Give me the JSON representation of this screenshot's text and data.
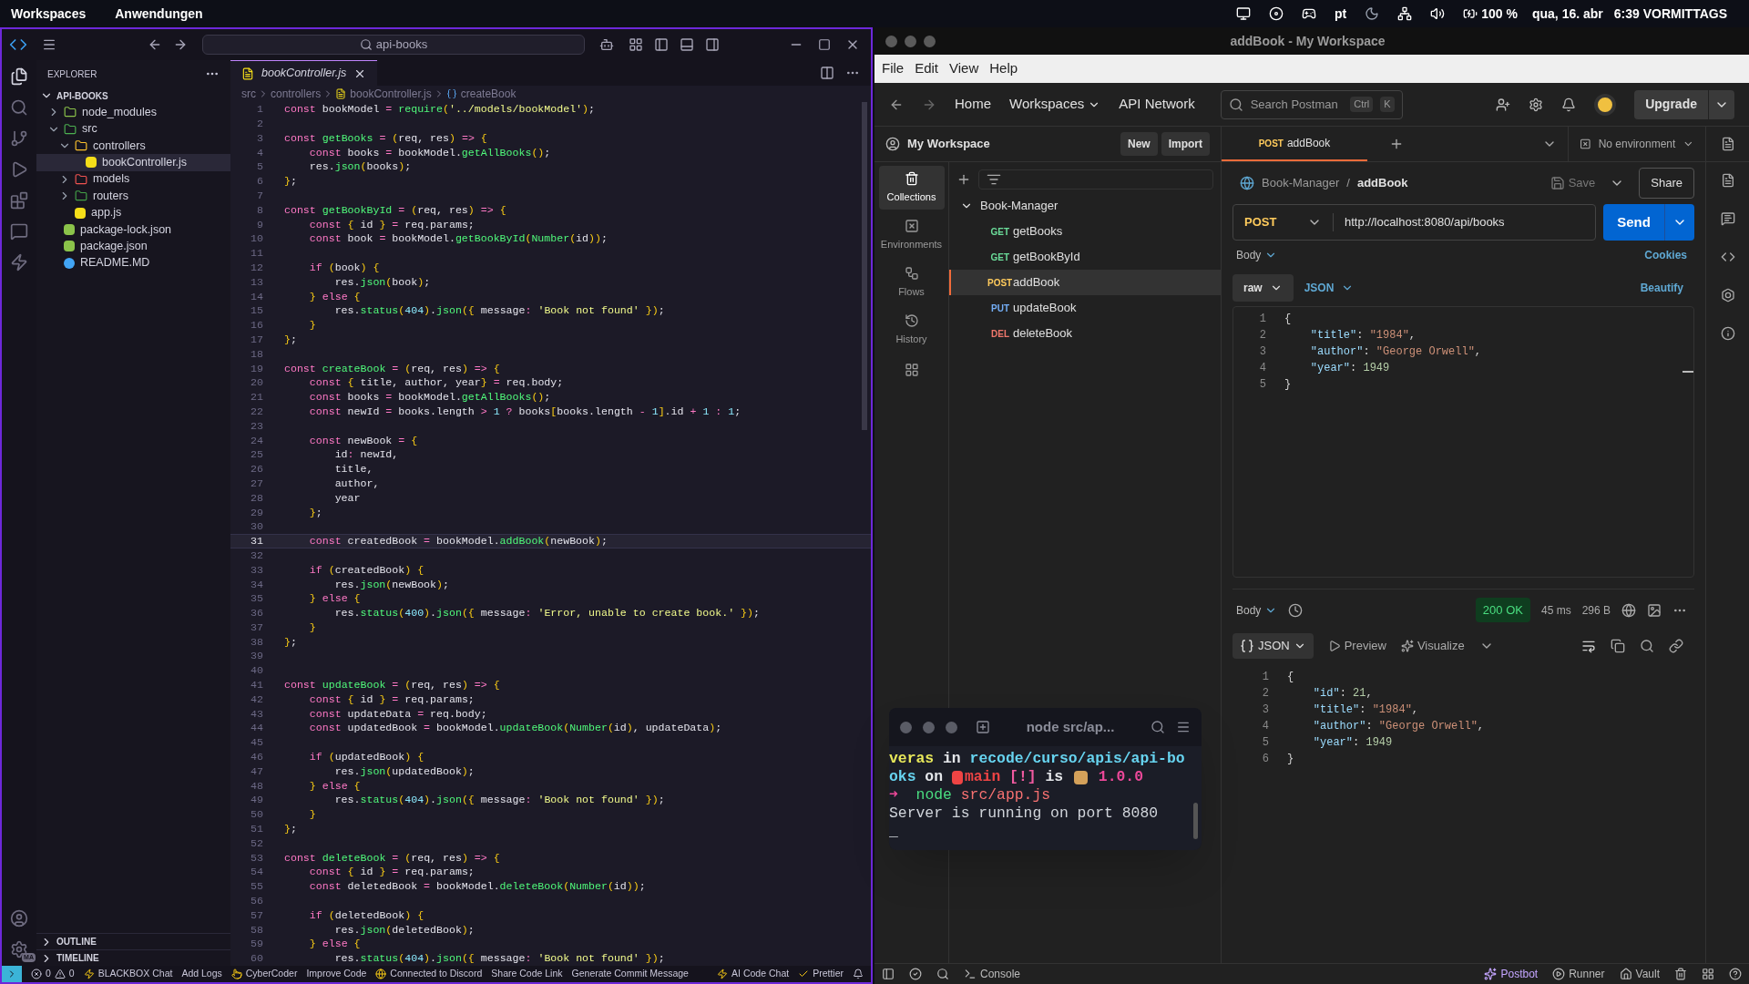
{
  "top_bar": {
    "menus": [
      "Workspaces",
      "Anwendungen"
    ],
    "keyboard": "pt",
    "battery": "100 %",
    "date": "qua, 16. abr",
    "time": "6:39 VORMITTAGS"
  },
  "vscode": {
    "search": "api-books",
    "explorer_title": "EXPLORER",
    "project": "API-BOOKS",
    "account_badge": "MA",
    "tree": [
      {
        "label": "node_modules",
        "kind": "folder",
        "expanded": false,
        "selected": false,
        "color": "#8bc34a"
      },
      {
        "label": "src",
        "kind": "folder",
        "expanded": true,
        "selected": false,
        "color": "#4caf50",
        "children": [
          {
            "label": "controllers",
            "kind": "folder",
            "expanded": true,
            "selected": false,
            "color": "#fbc02d",
            "children": [
              {
                "label": "bookController.js",
                "kind": "js",
                "selected": true,
                "color": "#f5de19"
              }
            ]
          },
          {
            "label": "models",
            "kind": "folder",
            "expanded": false,
            "selected": false,
            "color": "#ef5350"
          },
          {
            "label": "routers",
            "kind": "folder",
            "expanded": false,
            "selected": false,
            "color": "#43a047"
          },
          {
            "label": "app.js",
            "kind": "js",
            "selected": false,
            "color": "#f5de19"
          }
        ]
      },
      {
        "label": "package-lock.json",
        "kind": "json",
        "selected": false,
        "color": "#8bc34a"
      },
      {
        "label": "package.json",
        "kind": "json",
        "selected": false,
        "color": "#8bc34a"
      },
      {
        "label": "README.MD",
        "kind": "info",
        "selected": false,
        "color": "#42a5f5"
      }
    ],
    "sections": [
      {
        "label": "OUTLINE",
        "expanded": false
      },
      {
        "label": "TIMELINE",
        "expanded": false
      }
    ],
    "tab": {
      "label": "bookController.js"
    },
    "breadcrumb": [
      "src",
      "controllers",
      "bookController.js",
      "createBook"
    ],
    "lines": [
      {
        "n": "1",
        "code": "const bookModel = require('../models/bookModel');",
        "current": false
      },
      {
        "n": "2",
        "current": false
      },
      {
        "n": "3",
        "code": "const getBooks = (req, res) => {",
        "current": false
      },
      {
        "n": "4",
        "code": "    const books = bookModel.getAllBooks();",
        "current": false
      },
      {
        "n": "5",
        "code": "    res.json(books);",
        "current": false
      },
      {
        "n": "6",
        "code": "};",
        "current": false
      },
      {
        "n": "7",
        "current": false
      },
      {
        "n": "8",
        "code": "const getBookById = (req, res) => {",
        "current": false
      },
      {
        "n": "9",
        "code": "    const { id } = req.params;",
        "current": false
      },
      {
        "n": "10",
        "code": "    const book = bookModel.getBookById(Number(id));",
        "current": false
      },
      {
        "n": "11",
        "current": false
      },
      {
        "n": "12",
        "code": "    if (book) {",
        "current": false
      },
      {
        "n": "13",
        "code": "        res.json(book);",
        "current": false
      },
      {
        "n": "14",
        "code": "    } else {",
        "current": false
      },
      {
        "n": "15",
        "code": "        res.status(404).json({ message: 'Book not found' });",
        "current": false
      },
      {
        "n": "16",
        "code": "    }",
        "current": false
      },
      {
        "n": "17",
        "code": "};",
        "current": false
      },
      {
        "n": "18",
        "current": false
      },
      {
        "n": "19",
        "code": "const createBook = (req, res) => {",
        "current": false
      },
      {
        "n": "20",
        "code": "    const { title, author, year} = req.body;",
        "current": false
      },
      {
        "n": "21",
        "code": "    const books = bookModel.getAllBooks();",
        "current": false
      },
      {
        "n": "22",
        "code": "    const newId = books.length > 1 ? books[books.length - 1].id + 1 : 1;",
        "current": false
      },
      {
        "n": "23",
        "current": false
      },
      {
        "n": "24",
        "code": "    const newBook = {",
        "current": false
      },
      {
        "n": "25",
        "code": "        id: newId,",
        "current": false
      },
      {
        "n": "26",
        "code": "        title,",
        "current": false
      },
      {
        "n": "27",
        "code": "        author,",
        "current": false
      },
      {
        "n": "28",
        "code": "        year",
        "current": false
      },
      {
        "n": "29",
        "code": "    };",
        "current": false
      },
      {
        "n": "30",
        "current": false
      },
      {
        "n": "31",
        "code": "    const createdBook = bookModel.addBook(newBook);",
        "current": true
      },
      {
        "n": "32",
        "current": false
      },
      {
        "n": "33",
        "code": "    if (createdBook) {",
        "current": false
      },
      {
        "n": "34",
        "code": "        res.json(newBook);",
        "current": false
      },
      {
        "n": "35",
        "code": "    } else {",
        "current": false
      },
      {
        "n": "36",
        "code": "        res.status(400).json({ message: 'Error, unable to create book.' });",
        "current": false
      },
      {
        "n": "37",
        "code": "    }",
        "current": false
      },
      {
        "n": "38",
        "code": "};",
        "current": false
      },
      {
        "n": "39",
        "current": false
      },
      {
        "n": "40",
        "current": false
      },
      {
        "n": "41",
        "code": "const updateBook = (req, res) => {",
        "current": false
      },
      {
        "n": "42",
        "code": "    const { id } = req.params;",
        "current": false
      },
      {
        "n": "43",
        "code": "    const updateData = req.body;",
        "current": false
      },
      {
        "n": "44",
        "code": "    const updatedBook = bookModel.updateBook(Number(id), updateData);",
        "current": false
      },
      {
        "n": "45",
        "current": false
      },
      {
        "n": "46",
        "code": "    if (updatedBook) {",
        "current": false
      },
      {
        "n": "47",
        "code": "        res.json(updatedBook);",
        "current": false
      },
      {
        "n": "48",
        "code": "    } else {",
        "current": false
      },
      {
        "n": "49",
        "code": "        res.status(404).json({ message: 'Book not found' });",
        "current": false
      },
      {
        "n": "50",
        "code": "    }",
        "current": false
      },
      {
        "n": "51",
        "code": "};",
        "current": false
      },
      {
        "n": "52",
        "current": false
      },
      {
        "n": "53",
        "code": "const deleteBook = (req, res) => {",
        "current": false
      },
      {
        "n": "54",
        "code": "    const { id } = req.params;",
        "current": false
      },
      {
        "n": "55",
        "code": "    const deletedBook = bookModel.deleteBook(Number(id));",
        "current": false
      },
      {
        "n": "56",
        "current": false
      },
      {
        "n": "57",
        "code": "    if (deletedBook) {",
        "current": false
      },
      {
        "n": "58",
        "code": "        res.json(deletedBook);",
        "current": false
      },
      {
        "n": "59",
        "code": "    } else {",
        "current": false
      },
      {
        "n": "60",
        "code": "        res.status(404).json({ message: 'Book not found' });",
        "current": false
      }
    ],
    "problems": {
      "errors": "0",
      "warnings": "0"
    },
    "status_left": [
      {
        "label": "BLACKBOX Chat"
      },
      {
        "label": "Add Logs"
      },
      {
        "label": "CyberCoder"
      },
      {
        "label": "Improve Code"
      },
      {
        "label": "Connected to Discord"
      },
      {
        "label": "Share Code Link"
      },
      {
        "label": "Generate Commit Message"
      }
    ],
    "status_right": [
      {
        "label": "AI Code Chat"
      },
      {
        "label": "Prettier"
      }
    ]
  },
  "postman": {
    "title": "addBook - My Workspace",
    "menu": [
      "File",
      "Edit",
      "View",
      "Help"
    ],
    "nav": [
      "Home",
      "Workspaces",
      "API Network"
    ],
    "search": {
      "placeholder": "Search Postman",
      "keys": [
        "Ctrl",
        "K"
      ]
    },
    "upgrade": "Upgrade",
    "workspace": "My Workspace",
    "new": "New",
    "import": "Import",
    "side_nav": [
      {
        "label": "Collections",
        "selected": true
      },
      {
        "label": "Environments",
        "selected": false
      },
      {
        "label": "Flows",
        "selected": false
      },
      {
        "label": "History",
        "selected": false
      }
    ],
    "collection": {
      "name": "Book-Manager",
      "expanded": true,
      "requests": [
        {
          "method": "GET",
          "name": "getBooks",
          "color": "#6bdd9a",
          "selected": false
        },
        {
          "method": "GET",
          "name": "getBookById",
          "color": "#6bdd9a",
          "selected": false
        },
        {
          "method": "POST",
          "name": "addBook",
          "color": "#ffcb5c",
          "selected": true
        },
        {
          "method": "PUT",
          "name": "updateBook",
          "color": "#74aef6",
          "selected": false
        },
        {
          "method": "DEL",
          "name": "deleteBook",
          "color": "#f0776b",
          "selected": false
        }
      ]
    },
    "tab": {
      "method": "POST",
      "name": "addBook",
      "color": "#ffcb5c"
    },
    "environment": "No environment",
    "breadcrumb": {
      "collection": "Book-Manager",
      "separator": "/",
      "request": "addBook"
    },
    "save": "Save",
    "share": "Share",
    "method": "POST",
    "url": "http://localhost:8080/api/books",
    "send": "Send",
    "body_label": "Body",
    "cookies": "Cookies",
    "body_mode": "raw",
    "body_format": "JSON",
    "beautify": "Beautify",
    "request_body": [
      {
        "n": "1",
        "code": "{"
      },
      {
        "n": "2",
        "code": "    \"title\": \"1984\","
      },
      {
        "n": "3",
        "code": "    \"author\": \"George Orwell\","
      },
      {
        "n": "4",
        "code": "    \"year\": 1949"
      },
      {
        "n": "5",
        "code": "}"
      }
    ],
    "response": {
      "label": "Body",
      "status": "200 OK",
      "time": "45 ms",
      "size": "296 B",
      "format": "JSON",
      "preview": "Preview",
      "visualize": "Visualize",
      "lines": [
        {
          "n": "1",
          "code": "{"
        },
        {
          "n": "2",
          "code": "    \"id\": 21,"
        },
        {
          "n": "3",
          "code": "    \"title\": \"1984\","
        },
        {
          "n": "4",
          "code": "    \"author\": \"George Orwell\","
        },
        {
          "n": "5",
          "code": "    \"year\": 1949"
        },
        {
          "n": "6",
          "code": "}"
        }
      ]
    },
    "status_left": [
      "Console"
    ],
    "status_right": [
      {
        "label": "Postbot"
      },
      {
        "label": "Runner"
      },
      {
        "label": "Vault"
      }
    ]
  },
  "terminal": {
    "title": "node src/ap...",
    "lines": [
      {
        "bold": true,
        "segments": [
          {
            "kind": "text",
            "text": "veras",
            "color": "#e8e85a"
          },
          {
            "kind": "text",
            "text": " in ",
            "color": "#e5e7eb"
          },
          {
            "kind": "text",
            "text": "recode/curso/apis/api-bo",
            "color": "#67d4f0"
          }
        ]
      },
      {
        "bold": true,
        "segments": [
          {
            "kind": "text",
            "text": "oks",
            "color": "#67d4f0"
          },
          {
            "kind": "text",
            "text": " on ",
            "color": "#e5e7eb"
          },
          {
            "kind": "branch",
            "color": "#ef4444"
          },
          {
            "kind": "text",
            "text": "main",
            "color": "#ef4444"
          },
          {
            "kind": "text",
            "text": " [!]",
            "color": "#f05aa0"
          },
          {
            "kind": "text",
            "text": " is ",
            "color": "#e5e7eb"
          },
          {
            "kind": "package",
            "color": "#d4a15a"
          },
          {
            "kind": "text",
            "text": " 1.0.0",
            "color": "#ec4899"
          }
        ]
      },
      {
        "bold": false,
        "segments": [
          {
            "kind": "text",
            "text": "➜",
            "color": "#ec4899"
          },
          {
            "kind": "text",
            "text": "  node",
            "color": "#4ade80"
          },
          {
            "kind": "text",
            "text": " src/app.js",
            "color": "#f87171"
          }
        ]
      },
      {
        "bold": false,
        "segments": [
          {
            "kind": "text",
            "text": "Server is running on port 8080",
            "color": "#d1d5db"
          }
        ]
      },
      {
        "segments": [
          {
            "kind": "text",
            "text": "_"
          }
        ]
      }
    ]
  }
}
